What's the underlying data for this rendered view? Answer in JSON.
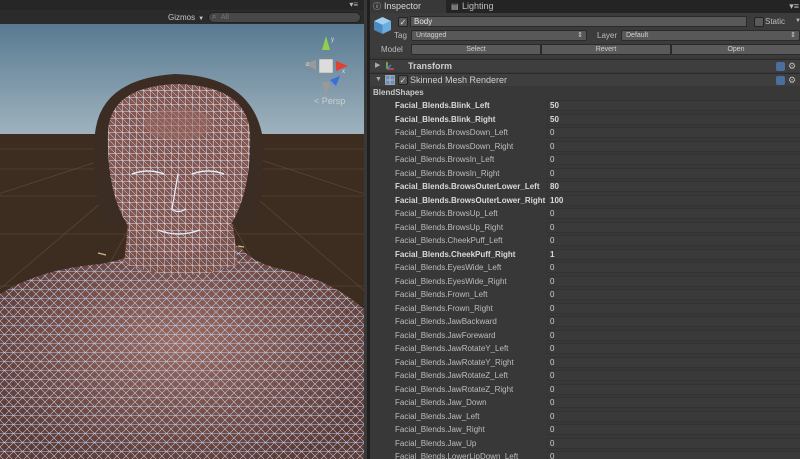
{
  "scene": {
    "gizmos_label": "Gizmos",
    "search_placeholder": "All",
    "view_label": "< Persp"
  },
  "inspector": {
    "tabs": [
      {
        "label": "Inspector",
        "icon": "info-icon"
      },
      {
        "label": "Lighting",
        "icon": "lighting-icon"
      }
    ],
    "object": {
      "name": "Body",
      "active": "✓",
      "static_label": "Static",
      "tag_label": "Tag",
      "tag_value": "Untagged",
      "layer_label": "Layer",
      "layer_value": "Default",
      "model_label": "Model",
      "model_buttons": [
        "Select",
        "Revert",
        "Open"
      ]
    },
    "components": [
      {
        "title": "Transform",
        "icon": "transform-icon"
      },
      {
        "title": "Skinned Mesh Renderer",
        "icon": "skinned-mesh-icon",
        "enabled": "✓"
      }
    ],
    "blendshapes_header": "BlendShapes",
    "blendshapes": [
      {
        "name": "Facial_Blends.Blink_Left",
        "value": "50",
        "bold": true
      },
      {
        "name": "Facial_Blends.Blink_Right",
        "value": "50",
        "bold": true
      },
      {
        "name": "Facial_Blends.BrowsDown_Left",
        "value": "0",
        "bold": false
      },
      {
        "name": "Facial_Blends.BrowsDown_Right",
        "value": "0",
        "bold": false
      },
      {
        "name": "Facial_Blends.BrowsIn_Left",
        "value": "0",
        "bold": false
      },
      {
        "name": "Facial_Blends.BrowsIn_Right",
        "value": "0",
        "bold": false
      },
      {
        "name": "Facial_Blends.BrowsOuterLower_Left",
        "value": "80",
        "bold": true
      },
      {
        "name": "Facial_Blends.BrowsOuterLower_Right",
        "value": "100",
        "bold": true
      },
      {
        "name": "Facial_Blends.BrowsUp_Left",
        "value": "0",
        "bold": false
      },
      {
        "name": "Facial_Blends.BrowsUp_Right",
        "value": "0",
        "bold": false
      },
      {
        "name": "Facial_Blends.CheekPuff_Left",
        "value": "0",
        "bold": false
      },
      {
        "name": "Facial_Blends.CheekPuff_Right",
        "value": "1",
        "bold": true
      },
      {
        "name": "Facial_Blends.EyesWide_Left",
        "value": "0",
        "bold": false
      },
      {
        "name": "Facial_Blends.EyesWide_Right",
        "value": "0",
        "bold": false
      },
      {
        "name": "Facial_Blends.Frown_Left",
        "value": "0",
        "bold": false
      },
      {
        "name": "Facial_Blends.Frown_Right",
        "value": "0",
        "bold": false
      },
      {
        "name": "Facial_Blends.JawBackward",
        "value": "0",
        "bold": false
      },
      {
        "name": "Facial_Blends.JawForeward",
        "value": "0",
        "bold": false
      },
      {
        "name": "Facial_Blends.JawRotateY_Left",
        "value": "0",
        "bold": false
      },
      {
        "name": "Facial_Blends.JawRotateY_Right",
        "value": "0",
        "bold": false
      },
      {
        "name": "Facial_Blends.JawRotateZ_Left",
        "value": "0",
        "bold": false
      },
      {
        "name": "Facial_Blends.JawRotateZ_Right",
        "value": "0",
        "bold": false
      },
      {
        "name": "Facial_Blends.Jaw_Down",
        "value": "0",
        "bold": false
      },
      {
        "name": "Facial_Blends.Jaw_Left",
        "value": "0",
        "bold": false
      },
      {
        "name": "Facial_Blends.Jaw_Right",
        "value": "0",
        "bold": false
      },
      {
        "name": "Facial_Blends.Jaw_Up",
        "value": "0",
        "bold": false
      },
      {
        "name": "Facial_Blends.LowerLipDown_Left",
        "value": "0",
        "bold": false
      }
    ]
  },
  "colors": {
    "skybox": "#6f8da2",
    "ground": "#3a2c20",
    "wireframe": "#a9c8f4",
    "skin": "#8a5a50",
    "hair": "#3a2c24"
  }
}
